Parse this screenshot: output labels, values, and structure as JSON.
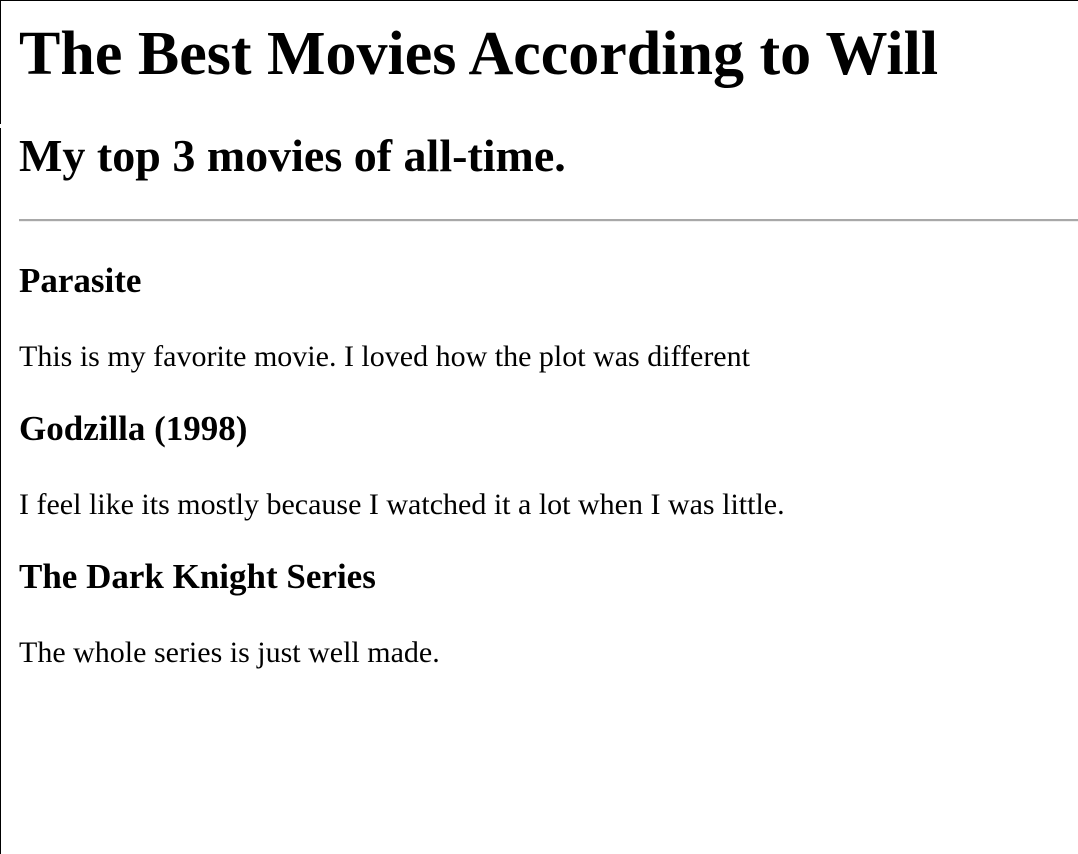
{
  "page": {
    "title": "The Best Movies According to Will",
    "subtitle": "My top 3 movies of all-time."
  },
  "movies": [
    {
      "title": "Parasite",
      "description": "This is my favorite movie. I loved how the plot was different"
    },
    {
      "title": "Godzilla (1998)",
      "description": "I feel like its mostly because I watched it a lot when I was little."
    },
    {
      "title": "The Dark Knight Series",
      "description": "The whole series is just well made."
    }
  ]
}
